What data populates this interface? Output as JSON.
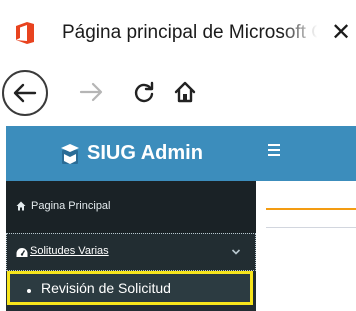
{
  "browser": {
    "tab_title": "Página principal de Microsoft C",
    "tab_close_glyph": "✕"
  },
  "app": {
    "brand_name": "SIUG Admin",
    "accent_color": "#3c8dbc",
    "highlight_color": "#f7e51c"
  },
  "sidebar": {
    "items": [
      {
        "label": "Pagina Principal",
        "icon": "home-icon"
      },
      {
        "label": "Solitudes Varias",
        "icon": "dashboard-icon",
        "expanded": true,
        "children": [
          {
            "label": "Revisión de Solicitud"
          }
        ]
      }
    ]
  }
}
